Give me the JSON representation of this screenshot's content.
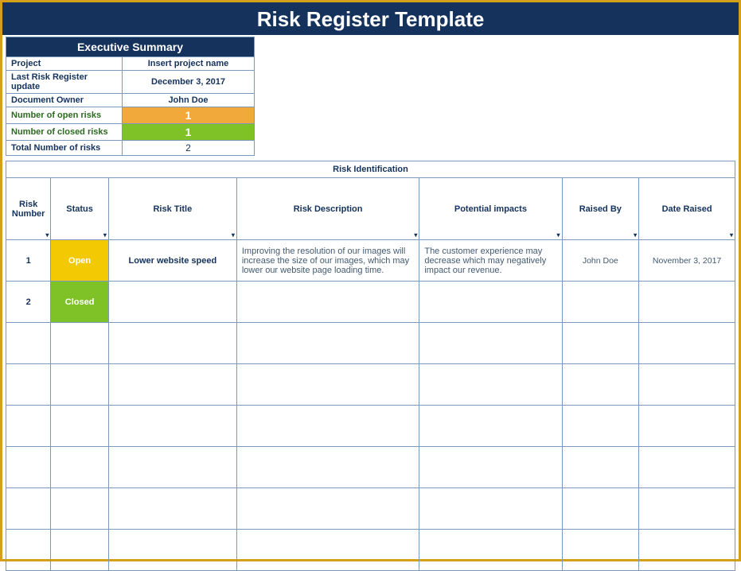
{
  "title": "Risk Register Template",
  "summary": {
    "header": "Executive Summary",
    "rows": {
      "project_label": "Project",
      "project_value": "Insert project name",
      "update_label": "Last Risk Register update",
      "update_value": "December 3, 2017",
      "owner_label": "Document Owner",
      "owner_value": "John Doe",
      "open_label": "Number of open risks",
      "open_value": "1",
      "closed_label": "Number of closed risks",
      "closed_value": "1",
      "total_label": "Total Number of risks",
      "total_value": "2"
    }
  },
  "section_header": "Risk Identification",
  "columns": {
    "num": "Risk Number",
    "status": "Status",
    "title": "Risk Title",
    "desc": "Risk Description",
    "impact": "Potential impacts",
    "raised_by": "Raised By",
    "date": "Date Raised"
  },
  "rows": [
    {
      "num": "1",
      "status": "Open",
      "status_class": "status-open",
      "title": "Lower website speed",
      "desc": "Improving the resolution of our images will increase the size of our images, which may lower our website page loading time.",
      "impact": "The customer experience may decrease which may negatively impact our revenue.",
      "raised_by": "John Doe",
      "date": "November 3, 2017"
    },
    {
      "num": "2",
      "status": "Closed",
      "status_class": "status-closed",
      "title": "",
      "desc": "",
      "impact": "",
      "raised_by": "",
      "date": ""
    }
  ]
}
